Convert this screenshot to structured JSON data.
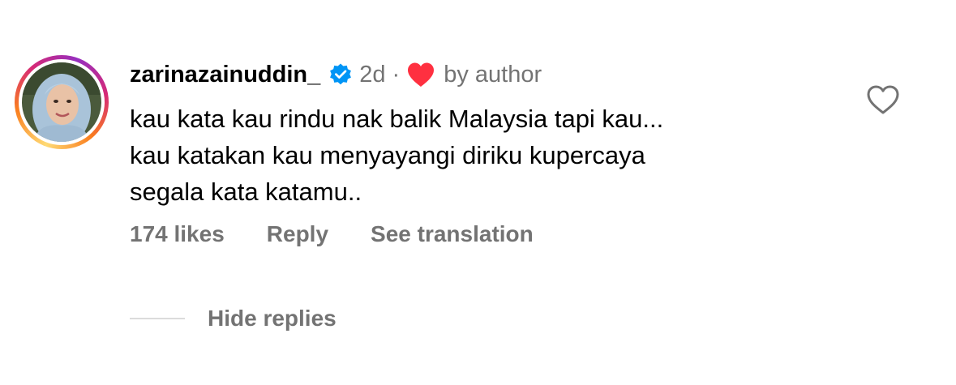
{
  "comment": {
    "username": "zarinazainuddin_",
    "time_ago": "2d",
    "separator": "·",
    "by_author_label": "by author",
    "text_lines": [
      "kau kata kau rindu nak balik Malaysia tapi kau...",
      "kau katakan kau menyayangi diriku kupercaya",
      "segala kata katamu.."
    ],
    "likes_label": "174 likes",
    "reply_label": "Reply",
    "see_translation_label": "See translation"
  },
  "replies": {
    "hide_label": "Hide replies"
  },
  "icons": {
    "verified": "verified-badge-icon",
    "author_heart": "heart-filled-icon",
    "like": "heart-outline-icon"
  },
  "colors": {
    "verified_blue": "#0095f6",
    "author_heart_red": "#ff3040",
    "secondary_text": "#737373",
    "divider": "#dbdbdb"
  }
}
